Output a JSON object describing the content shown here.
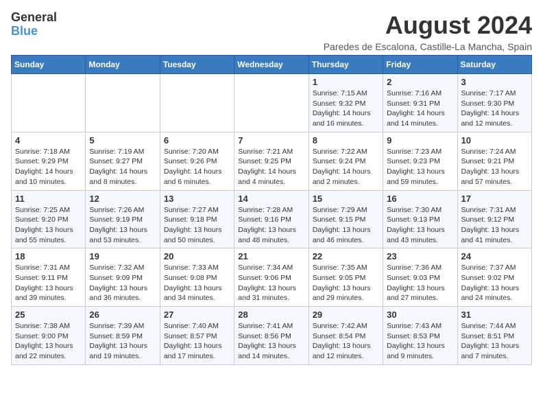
{
  "header": {
    "logo_line1": "General",
    "logo_line2": "Blue",
    "month_title": "August 2024",
    "location": "Paredes de Escalona, Castille-La Mancha, Spain"
  },
  "weekdays": [
    "Sunday",
    "Monday",
    "Tuesday",
    "Wednesday",
    "Thursday",
    "Friday",
    "Saturday"
  ],
  "weeks": [
    [
      {
        "day": "",
        "info": ""
      },
      {
        "day": "",
        "info": ""
      },
      {
        "day": "",
        "info": ""
      },
      {
        "day": "",
        "info": ""
      },
      {
        "day": "1",
        "info": "Sunrise: 7:15 AM\nSunset: 9:32 PM\nDaylight: 14 hours\nand 16 minutes."
      },
      {
        "day": "2",
        "info": "Sunrise: 7:16 AM\nSunset: 9:31 PM\nDaylight: 14 hours\nand 14 minutes."
      },
      {
        "day": "3",
        "info": "Sunrise: 7:17 AM\nSunset: 9:30 PM\nDaylight: 14 hours\nand 12 minutes."
      }
    ],
    [
      {
        "day": "4",
        "info": "Sunrise: 7:18 AM\nSunset: 9:29 PM\nDaylight: 14 hours\nand 10 minutes."
      },
      {
        "day": "5",
        "info": "Sunrise: 7:19 AM\nSunset: 9:27 PM\nDaylight: 14 hours\nand 8 minutes."
      },
      {
        "day": "6",
        "info": "Sunrise: 7:20 AM\nSunset: 9:26 PM\nDaylight: 14 hours\nand 6 minutes."
      },
      {
        "day": "7",
        "info": "Sunrise: 7:21 AM\nSunset: 9:25 PM\nDaylight: 14 hours\nand 4 minutes."
      },
      {
        "day": "8",
        "info": "Sunrise: 7:22 AM\nSunset: 9:24 PM\nDaylight: 14 hours\nand 2 minutes."
      },
      {
        "day": "9",
        "info": "Sunrise: 7:23 AM\nSunset: 9:23 PM\nDaylight: 13 hours\nand 59 minutes."
      },
      {
        "day": "10",
        "info": "Sunrise: 7:24 AM\nSunset: 9:21 PM\nDaylight: 13 hours\nand 57 minutes."
      }
    ],
    [
      {
        "day": "11",
        "info": "Sunrise: 7:25 AM\nSunset: 9:20 PM\nDaylight: 13 hours\nand 55 minutes."
      },
      {
        "day": "12",
        "info": "Sunrise: 7:26 AM\nSunset: 9:19 PM\nDaylight: 13 hours\nand 53 minutes."
      },
      {
        "day": "13",
        "info": "Sunrise: 7:27 AM\nSunset: 9:18 PM\nDaylight: 13 hours\nand 50 minutes."
      },
      {
        "day": "14",
        "info": "Sunrise: 7:28 AM\nSunset: 9:16 PM\nDaylight: 13 hours\nand 48 minutes."
      },
      {
        "day": "15",
        "info": "Sunrise: 7:29 AM\nSunset: 9:15 PM\nDaylight: 13 hours\nand 46 minutes."
      },
      {
        "day": "16",
        "info": "Sunrise: 7:30 AM\nSunset: 9:13 PM\nDaylight: 13 hours\nand 43 minutes."
      },
      {
        "day": "17",
        "info": "Sunrise: 7:31 AM\nSunset: 9:12 PM\nDaylight: 13 hours\nand 41 minutes."
      }
    ],
    [
      {
        "day": "18",
        "info": "Sunrise: 7:31 AM\nSunset: 9:11 PM\nDaylight: 13 hours\nand 39 minutes."
      },
      {
        "day": "19",
        "info": "Sunrise: 7:32 AM\nSunset: 9:09 PM\nDaylight: 13 hours\nand 36 minutes."
      },
      {
        "day": "20",
        "info": "Sunrise: 7:33 AM\nSunset: 9:08 PM\nDaylight: 13 hours\nand 34 minutes."
      },
      {
        "day": "21",
        "info": "Sunrise: 7:34 AM\nSunset: 9:06 PM\nDaylight: 13 hours\nand 31 minutes."
      },
      {
        "day": "22",
        "info": "Sunrise: 7:35 AM\nSunset: 9:05 PM\nDaylight: 13 hours\nand 29 minutes."
      },
      {
        "day": "23",
        "info": "Sunrise: 7:36 AM\nSunset: 9:03 PM\nDaylight: 13 hours\nand 27 minutes."
      },
      {
        "day": "24",
        "info": "Sunrise: 7:37 AM\nSunset: 9:02 PM\nDaylight: 13 hours\nand 24 minutes."
      }
    ],
    [
      {
        "day": "25",
        "info": "Sunrise: 7:38 AM\nSunset: 9:00 PM\nDaylight: 13 hours\nand 22 minutes."
      },
      {
        "day": "26",
        "info": "Sunrise: 7:39 AM\nSunset: 8:59 PM\nDaylight: 13 hours\nand 19 minutes."
      },
      {
        "day": "27",
        "info": "Sunrise: 7:40 AM\nSunset: 8:57 PM\nDaylight: 13 hours\nand 17 minutes."
      },
      {
        "day": "28",
        "info": "Sunrise: 7:41 AM\nSunset: 8:56 PM\nDaylight: 13 hours\nand 14 minutes."
      },
      {
        "day": "29",
        "info": "Sunrise: 7:42 AM\nSunset: 8:54 PM\nDaylight: 13 hours\nand 12 minutes."
      },
      {
        "day": "30",
        "info": "Sunrise: 7:43 AM\nSunset: 8:53 PM\nDaylight: 13 hours\nand 9 minutes."
      },
      {
        "day": "31",
        "info": "Sunrise: 7:44 AM\nSunset: 8:51 PM\nDaylight: 13 hours\nand 7 minutes."
      }
    ]
  ]
}
